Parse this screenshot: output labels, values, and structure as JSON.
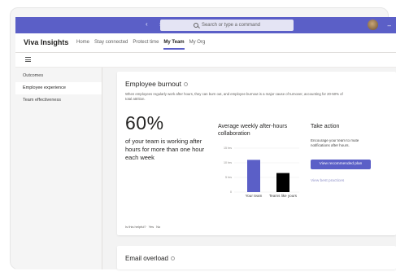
{
  "titlebar": {
    "nav_arrows": "‹  ›",
    "search_placeholder": "Search or type a command"
  },
  "app": {
    "title": "Viva Insights",
    "tabs": [
      {
        "label": "Home"
      },
      {
        "label": "Stay connected"
      },
      {
        "label": "Protect time"
      },
      {
        "label": "My Team"
      },
      {
        "label": "My Org"
      }
    ],
    "active_tab": "My Team"
  },
  "sidebar": {
    "items": [
      {
        "label": "Outcomes"
      },
      {
        "label": "Employee experience"
      },
      {
        "label": "Team effectiveness"
      }
    ],
    "active_item": "Employee experience"
  },
  "burnout_card": {
    "title": "Employee burnout",
    "description": "When employees regularly work after hours, they can burn out, and employee burnout is a major cause of turnover, accounting for 20-50% of total attrition.",
    "big_stat": "60%",
    "stat_description": "of your team is working after hours for more than one hour each week",
    "chart_title": "Average weekly after-hours collaboration",
    "take_action": {
      "heading": "Take action",
      "description": "Encourage your team to mute notifications after hours.",
      "button_label": "View recommended plan",
      "link_label": "View best practices"
    },
    "helpful": {
      "question": "Is this helpful?",
      "yes": "Yes",
      "no": "No"
    }
  },
  "email_card": {
    "title": "Email overload"
  },
  "colors": {
    "accent": "#5b5fc7",
    "bar_your_team": "#5b5fc7",
    "bar_teams_like_yours": "#000000"
  },
  "chart_data": {
    "type": "bar",
    "title": "Average weekly after-hours collaboration",
    "categories": [
      "Your team",
      "Teams like yours"
    ],
    "values": [
      11,
      6.5
    ],
    "yticks": [
      "15 hrs",
      "10 hrs",
      "5 hrs",
      "0"
    ],
    "ylim": [
      0,
      15
    ],
    "grid": true
  }
}
